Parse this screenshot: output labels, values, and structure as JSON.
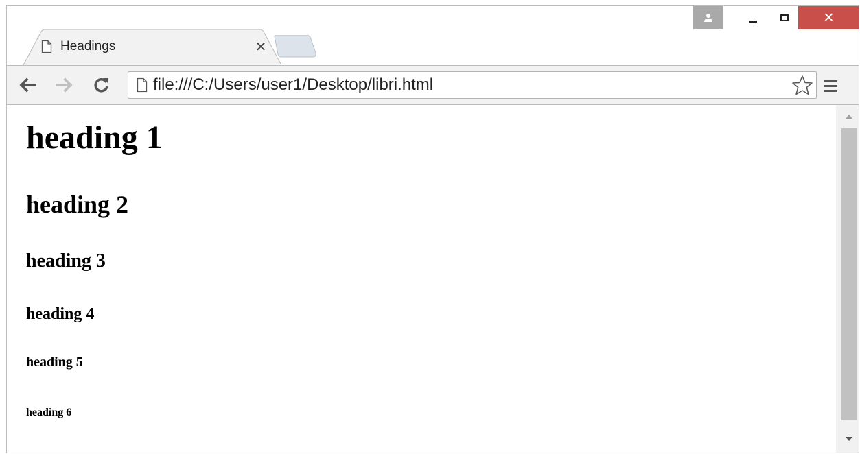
{
  "window": {
    "controls": {
      "user_icon": "user-icon",
      "minimize_icon": "minimize-icon",
      "maximize_icon": "maximize-icon",
      "close_symbol": "✕"
    }
  },
  "tabs": [
    {
      "title": "Headings",
      "close_symbol": "✕"
    }
  ],
  "toolbar": {
    "back_icon": "back-arrow-icon",
    "forward_icon": "forward-arrow-icon",
    "reload_icon": "reload-icon",
    "url": "file:///C:/Users/user1/Desktop/libri.html",
    "bookmark_icon": "star-icon",
    "menu_icon": "hamburger-menu-icon"
  },
  "page": {
    "headings": [
      {
        "level": 1,
        "text": "heading 1"
      },
      {
        "level": 2,
        "text": "heading 2"
      },
      {
        "level": 3,
        "text": "heading 3"
      },
      {
        "level": 4,
        "text": "heading 4"
      },
      {
        "level": 5,
        "text": "heading 5"
      },
      {
        "level": 6,
        "text": "heading 6"
      }
    ]
  },
  "colors": {
    "close_button": "#c9504a",
    "user_button": "#a9a9a9",
    "toolbar_bg": "#f2f2f2",
    "scrollbar_thumb": "#c1c1c1"
  }
}
